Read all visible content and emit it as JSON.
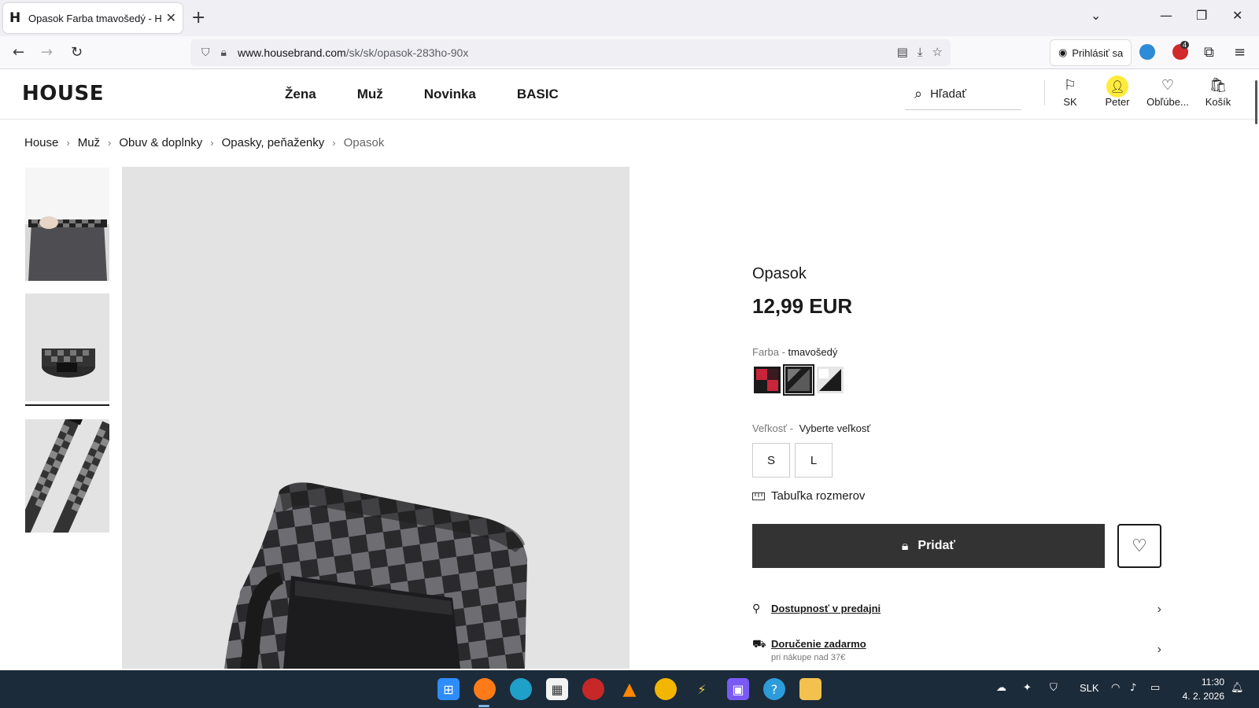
{
  "browser": {
    "tab_title": "Opasok Farba tmavošedý - HOUSE",
    "tab_favicon": "H",
    "url_domain": "www.housebrand.com",
    "url_path": "/sk/sk/opasok-283ho-90x",
    "signin_label": "Prihlásiť sa",
    "adblock_badge": "4"
  },
  "site": {
    "logo": "HOUSE",
    "nav": [
      "Žena",
      "Muž",
      "Novinka",
      "BASIC"
    ],
    "search_placeholder": "Hľadať",
    "header_items": {
      "country": "SK",
      "account": "Peter",
      "favorites": "Obľúbe...",
      "cart": "Košík"
    }
  },
  "breadcrumb": [
    "House",
    "Muž",
    "Obuv & doplnky",
    "Opasky, peňaženky",
    "Opasok"
  ],
  "product": {
    "title": "Opasok",
    "price": "12,99 EUR",
    "color_label": "Farba - ",
    "color_value": "tmavošedý",
    "swatches": [
      {
        "name": "red-black",
        "colors": [
          "#c8253a",
          "#1b1b1b"
        ]
      },
      {
        "name": "dark-grey",
        "colors": [
          "#5a5a5a",
          "#1b1b1b"
        ],
        "selected": true
      },
      {
        "name": "white-black",
        "colors": [
          "#f0f0f0",
          "#1b1b1b"
        ]
      }
    ],
    "size_label": "Veľkosť - ",
    "size_value": "Vyberte veľkosť",
    "sizes": [
      "S",
      "L"
    ],
    "size_chart_label": "Tabuľka rozmerov",
    "add_to_cart_label": "Pridať",
    "availability_label": "Dostupnosť v predajni",
    "delivery_label": "Doručenie zadarmo",
    "delivery_sub": "pri nákupe nad 37€"
  },
  "taskbar": {
    "language": "SLK",
    "time": "11:30",
    "date": "4. 2. 2026"
  },
  "colors": {
    "button_dark": "#333333",
    "accent_yellow": "#ffeb3b",
    "taskbar": "#1c2b3a"
  }
}
